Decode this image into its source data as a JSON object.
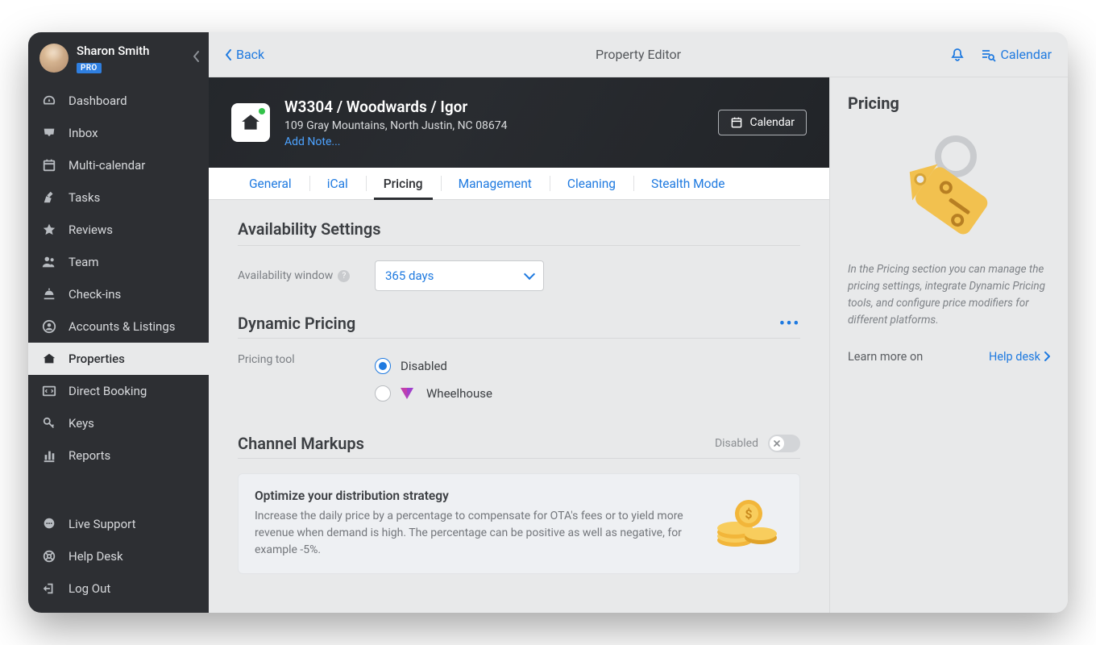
{
  "user": {
    "name": "Sharon Smith",
    "badge": "PRO"
  },
  "sidebar": {
    "items": [
      {
        "label": "Dashboard"
      },
      {
        "label": "Inbox"
      },
      {
        "label": "Multi-calendar"
      },
      {
        "label": "Tasks"
      },
      {
        "label": "Reviews"
      },
      {
        "label": "Team"
      },
      {
        "label": "Check-ins"
      },
      {
        "label": "Accounts & Listings"
      },
      {
        "label": "Properties"
      },
      {
        "label": "Direct Booking"
      },
      {
        "label": "Keys"
      },
      {
        "label": "Reports"
      }
    ],
    "bottom": [
      {
        "label": "Live Support"
      },
      {
        "label": "Help Desk"
      },
      {
        "label": "Log Out"
      }
    ]
  },
  "topbar": {
    "back": "Back",
    "title": "Property Editor",
    "calendar": "Calendar"
  },
  "property": {
    "title": "W3304 / Woodwards / Igor",
    "address": "109 Gray Mountains, North Justin, NC 08674",
    "add_note": "Add Note...",
    "calendar_btn": "Calendar"
  },
  "tabs": [
    "General",
    "iCal",
    "Pricing",
    "Management",
    "Cleaning",
    "Stealth Mode"
  ],
  "availability": {
    "heading": "Availability Settings",
    "window_label": "Availability window",
    "window_value": "365 days"
  },
  "dynamic": {
    "heading": "Dynamic Pricing",
    "tool_label": "Pricing tool",
    "options": {
      "disabled": "Disabled",
      "wheelhouse": "Wheelhouse"
    }
  },
  "markups": {
    "heading": "Channel Markups",
    "state": "Disabled",
    "card_title": "Optimize your distribution strategy",
    "card_body": "Increase the daily price by a percentage to compensate for OTA's fees or to yield more revenue when demand is high. The percentage can be positive as well as negative, for example -5%."
  },
  "right": {
    "heading": "Pricing",
    "desc": "In the Pricing section you can manage the pricing settings, integrate Dynamic Pricing tools, and configure price modifiers for different platforms.",
    "learn_label": "Learn more on",
    "learn_link": "Help desk"
  }
}
